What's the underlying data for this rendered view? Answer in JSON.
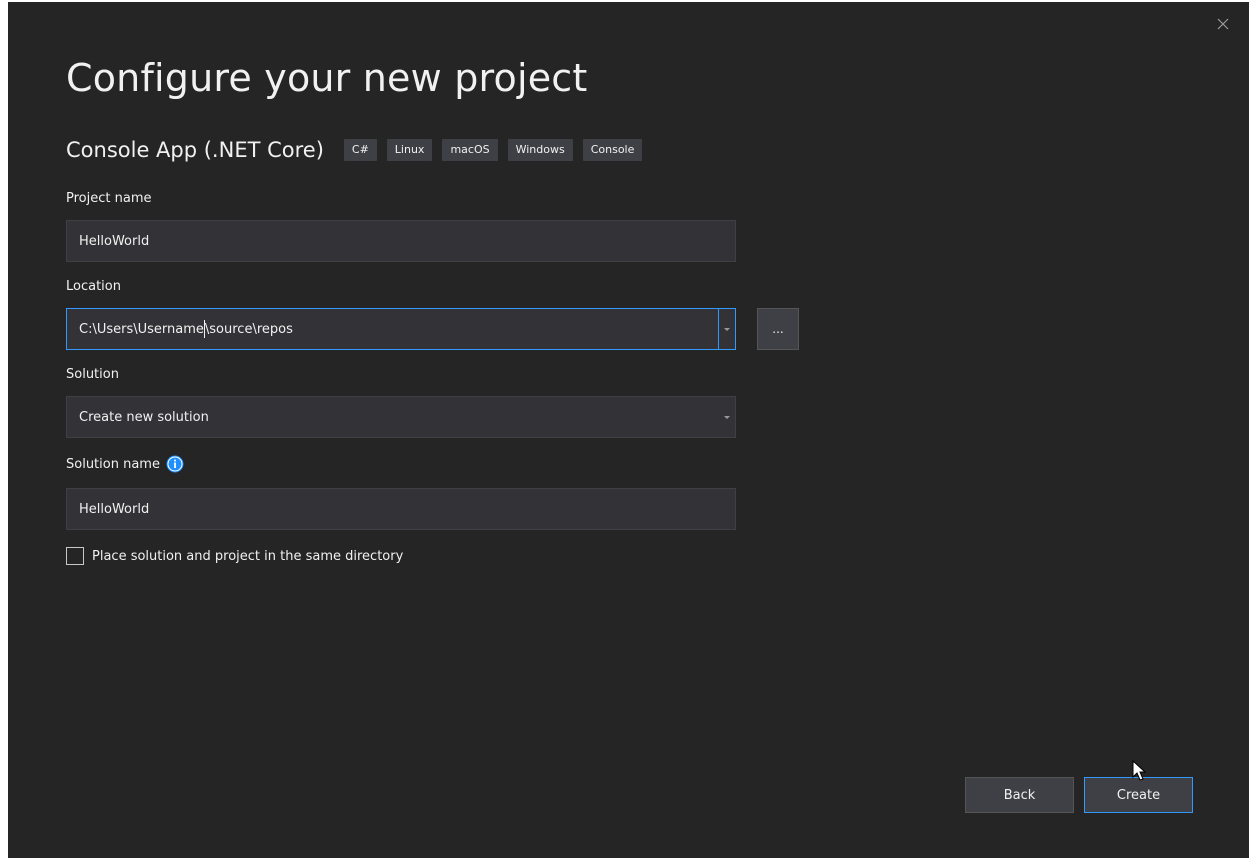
{
  "window": {
    "title": "Configure your new project",
    "close_label": "×"
  },
  "template": {
    "name": "Console App (.NET Core)",
    "tags": [
      "C#",
      "Linux",
      "macOS",
      "Windows",
      "Console"
    ]
  },
  "fields": {
    "project_name": {
      "label": "Project name",
      "value": "HelloWorld"
    },
    "location": {
      "label": "Location",
      "value_before_caret": "C:\\Users\\Username",
      "value_after_caret": "\\source\\repos",
      "browse_label": "..."
    },
    "solution": {
      "label": "Solution",
      "value": "Create new solution"
    },
    "solution_name": {
      "label": "Solution name",
      "value": "HelloWorld"
    }
  },
  "options": {
    "same_directory_label": "Place solution and project in the same directory",
    "same_directory_checked": false
  },
  "buttons": {
    "back_label": "Back",
    "create_label": "Create"
  },
  "colors": {
    "background": "#252526",
    "input_background": "#333337",
    "focus_border": "#3399ff",
    "info_icon": "#1e90ff"
  },
  "icons": {
    "close": "close-icon",
    "info": "info-icon",
    "dropdown": "chevron-down-icon",
    "cursor": "mouse-pointer-icon"
  }
}
